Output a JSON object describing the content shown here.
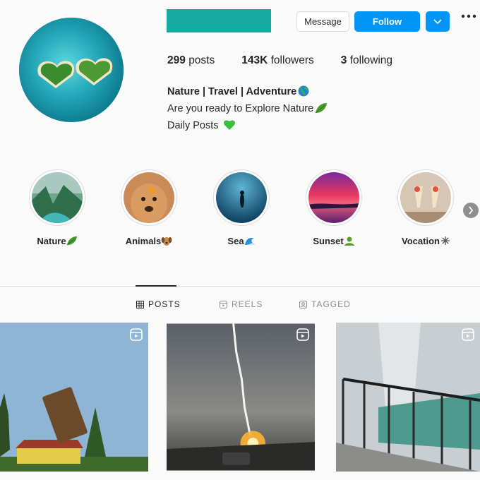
{
  "profile": {
    "buttons": {
      "message": "Message",
      "follow": "Follow"
    },
    "stats": [
      {
        "count": "299",
        "label": "posts"
      },
      {
        "count": "143K",
        "label": "followers"
      },
      {
        "count": "3",
        "label": "following"
      }
    ],
    "bio": {
      "name": "Nature | Travel | Adventure",
      "line1": "Are you ready to Explore Nature",
      "line2": "Daily Posts"
    }
  },
  "highlights": [
    {
      "label": "Nature",
      "icon": "leaf-icon"
    },
    {
      "label": "Animals",
      "icon": "dog-icon"
    },
    {
      "label": "Sea",
      "icon": "wave-icon"
    },
    {
      "label": "Sunset",
      "icon": "person-icon"
    },
    {
      "label": "Vocation",
      "icon": "sparkle-icon"
    }
  ],
  "tabs": [
    {
      "label": "POSTS",
      "icon": "grid-icon",
      "active": true
    },
    {
      "label": "REELS",
      "icon": "reels-icon",
      "active": false
    },
    {
      "label": "TAGGED",
      "icon": "tag-icon",
      "active": false
    }
  ],
  "posts": [
    {
      "type": "reel",
      "icon": "reels-icon"
    },
    {
      "type": "reel",
      "icon": "reels-icon"
    },
    {
      "type": "reel",
      "icon": "reels-icon"
    }
  ],
  "colors": {
    "accent": "#0095f6",
    "username_redaction": "#17aaa0",
    "text": "#262626",
    "muted": "#8e8e8e"
  }
}
